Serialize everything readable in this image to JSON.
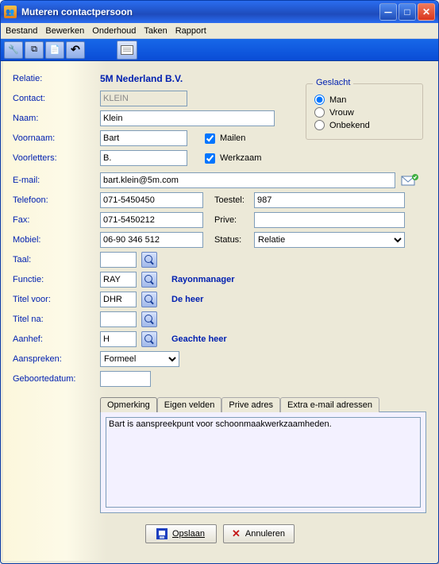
{
  "window": {
    "title": "Muteren contactpersoon"
  },
  "menu": {
    "file": "Bestand",
    "edit": "Bewerken",
    "maint": "Onderhoud",
    "tasks": "Taken",
    "report": "Rapport"
  },
  "labels": {
    "relation": "Relatie:",
    "contact": "Contact:",
    "name": "Naam:",
    "firstname": "Voornaam:",
    "initials": "Voorletters:",
    "email": "E-mail:",
    "phone": "Telefoon:",
    "fax": "Fax:",
    "mobile": "Mobiel:",
    "language": "Taal:",
    "function": "Functie:",
    "titlebefore": "Titel voor:",
    "titleafter": "Titel na:",
    "salutation": "Aanhef:",
    "address_as": "Aanspreken:",
    "birthdate": "Geboortedatum:",
    "extension": "Toestel:",
    "private": "Prive:",
    "status": "Status:",
    "mailing": "Mailen",
    "active": "Werkzaam"
  },
  "gender": {
    "legend": "Geslacht",
    "male": "Man",
    "female": "Vrouw",
    "unknown": "Onbekend",
    "selected": "male"
  },
  "values": {
    "company": "5M Nederland B.V.",
    "contact": "KLEIN",
    "name": "Klein",
    "firstname": "Bart",
    "initials": "B.",
    "email": "bart.klein@5m.com",
    "phone": "071-5450450",
    "fax": "071-5450212",
    "mobile": "06-90 346 512",
    "extension": "987",
    "private": "",
    "status": "Relatie",
    "language": "",
    "function": "RAY",
    "function_desc": "Rayonmanager",
    "titlebefore": "DHR",
    "titlebefore_desc": "De heer",
    "titleafter": "",
    "salutation": "H",
    "salutation_desc": "Geachte heer",
    "address_as": "Formeel",
    "birthdate": "",
    "mailing_checked": true,
    "active_checked": true
  },
  "tabs": {
    "t1": "Opmerking",
    "t2": "Eigen velden",
    "t3": "Prive adres",
    "t4": "Extra e-mail adressen",
    "active": "t1"
  },
  "memo": "Bart is aanspreekpunt voor schoonmaakwerkzaamheden.",
  "buttons": {
    "save": "Opslaan",
    "cancel": "Annuleren"
  }
}
